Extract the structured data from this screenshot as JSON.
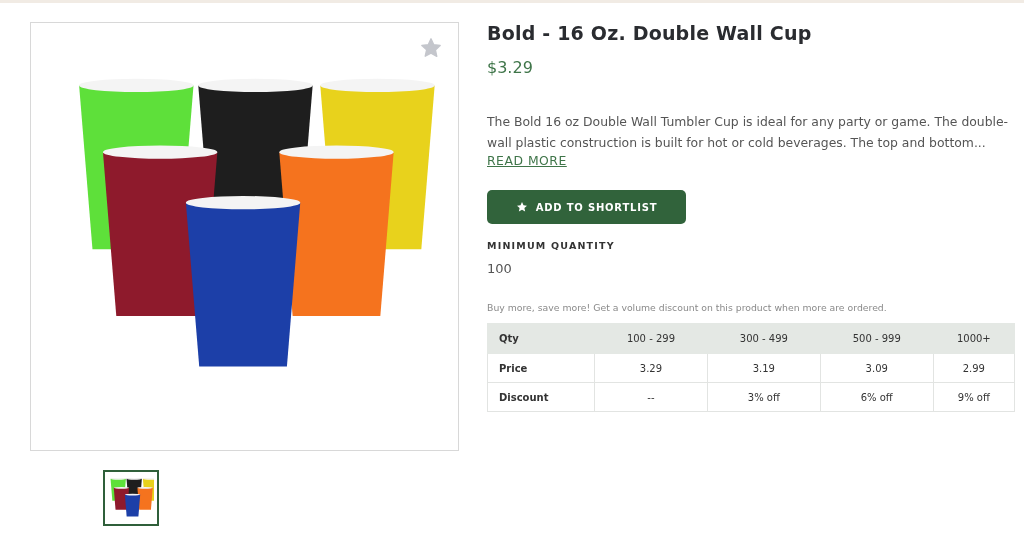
{
  "gallery": {
    "thumbnails": [
      {
        "selected": true
      }
    ]
  },
  "product": {
    "title": "Bold - 16 Oz. Double Wall Cup",
    "price": "$3.29",
    "description": "The Bold 16 oz Double Wall Tumbler Cup is ideal for any party or game. The double-wall plastic construction is built for hot or cold beverages. The top and bottom...",
    "read_more": "READ MORE",
    "shortlist_button": "ADD TO SHORTLIST",
    "min_quantity_label": "MINIMUM QUANTITY",
    "min_quantity": "100",
    "discount_note": "Buy more, save more! Get a volume discount on this product when more are ordered."
  },
  "table": {
    "columns": [
      "Qty",
      "100 - 299",
      "300 - 499",
      "500 - 999",
      "1000+"
    ],
    "rows": [
      [
        "Price",
        "3.29",
        "3.19",
        "3.09",
        "2.99"
      ],
      [
        "Discount",
        "--",
        "3% off",
        "6% off",
        "9% off"
      ]
    ]
  }
}
